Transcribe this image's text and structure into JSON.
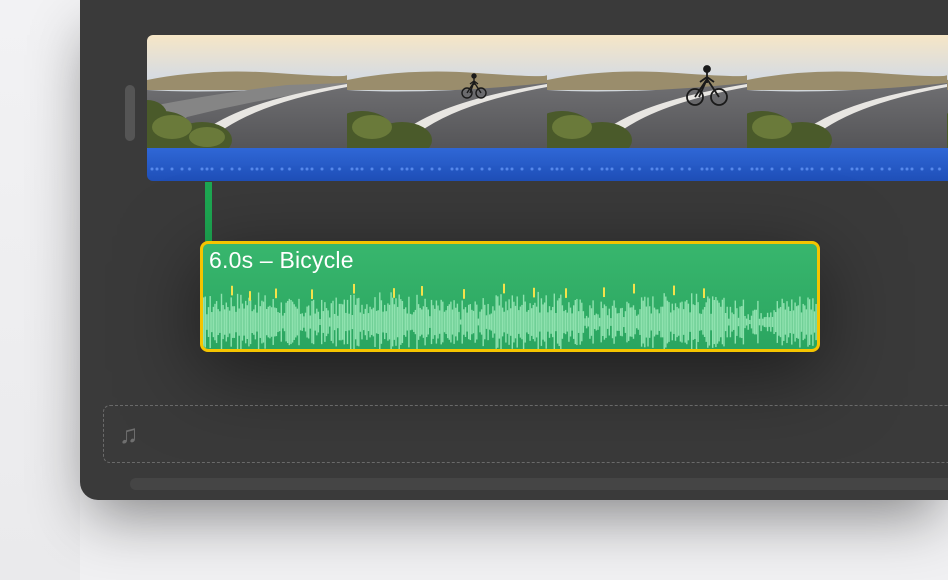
{
  "timeline": {
    "video_track": {
      "thumbnails": [
        {
          "name": "frame-1"
        },
        {
          "name": "frame-2"
        },
        {
          "name": "frame-3"
        },
        {
          "name": "frame-4"
        }
      ],
      "has_audio_strip": true
    },
    "audio_clip": {
      "duration_label": "6.0s",
      "title": "Bicycle",
      "display_label": "6.0s – Bicycle",
      "selected": true,
      "selection_color": "#f5c400",
      "fill_color": "#2fa963"
    },
    "music_well": {
      "icon": "music-note-icon",
      "glyph": "♫",
      "empty": true
    }
  },
  "colors": {
    "panel_bg": "#3a3a3a",
    "video_audio_strip": "#2a5ad0",
    "audio_clip_green": "#2fa963",
    "audio_clip_border": "#f5c400"
  }
}
